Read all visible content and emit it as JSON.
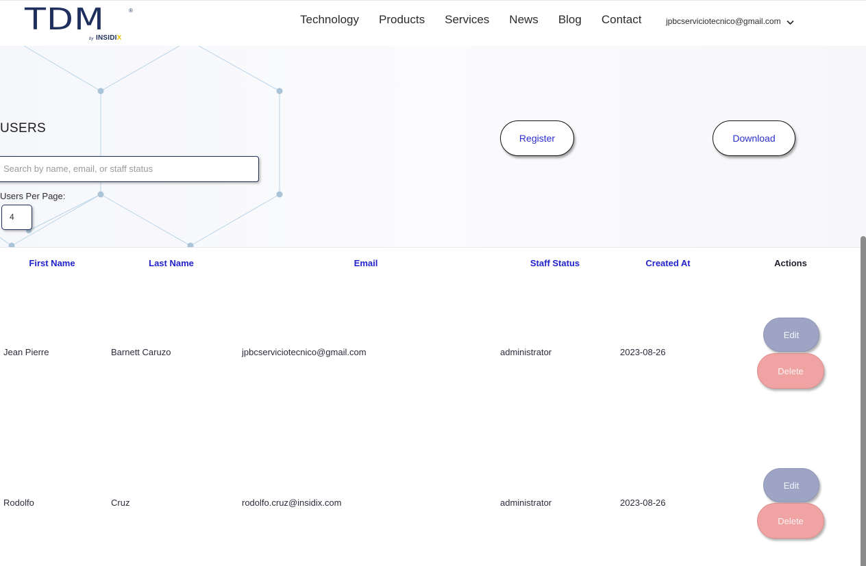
{
  "header": {
    "logo_text": "TDM",
    "logo_reg": "®",
    "logo_by": "by",
    "logo_brand": "INSIDI",
    "logo_brand_x": "X",
    "nav": [
      "Technology",
      "Products",
      "Services",
      "News",
      "Blog",
      "Contact"
    ],
    "account_email": "jpbcserviciotecnico@gmail.com"
  },
  "page": {
    "title": "USERS",
    "search_placeholder": "Search by name, email, or staff status",
    "users_per_page_label": "Users Per Page:",
    "users_per_page_value": "4",
    "register_label": "Register",
    "download_label": "Download"
  },
  "table": {
    "columns": [
      "First Name",
      "Last Name",
      "Email",
      "Staff Status",
      "Created At",
      "Actions"
    ],
    "rows": [
      {
        "first_name": "Jean Pierre",
        "last_name": "Barnett Caruzo",
        "email": "jpbcserviciotecnico@gmail.com",
        "staff_status": "administrator",
        "created_at": "2023-08-26",
        "edit_label": "Edit",
        "delete_label": "Delete"
      },
      {
        "first_name": "Rodolfo",
        "last_name": "Cruz",
        "email": "rodolfo.cruz@insidix.com",
        "staff_status": "administrator",
        "created_at": "2023-08-26",
        "edit_label": "Edit",
        "delete_label": "Delete"
      }
    ]
  },
  "icons": {
    "account_menu": "chevron-down-icon",
    "visibility": "eye-slash-icon"
  },
  "colors": {
    "brand_navy": "#1f2f5e",
    "brand_yellow": "#f2c100",
    "link_blue": "#2222cc",
    "edit_button": "#9ea5c4",
    "delete_button": "#f0a3a3"
  }
}
